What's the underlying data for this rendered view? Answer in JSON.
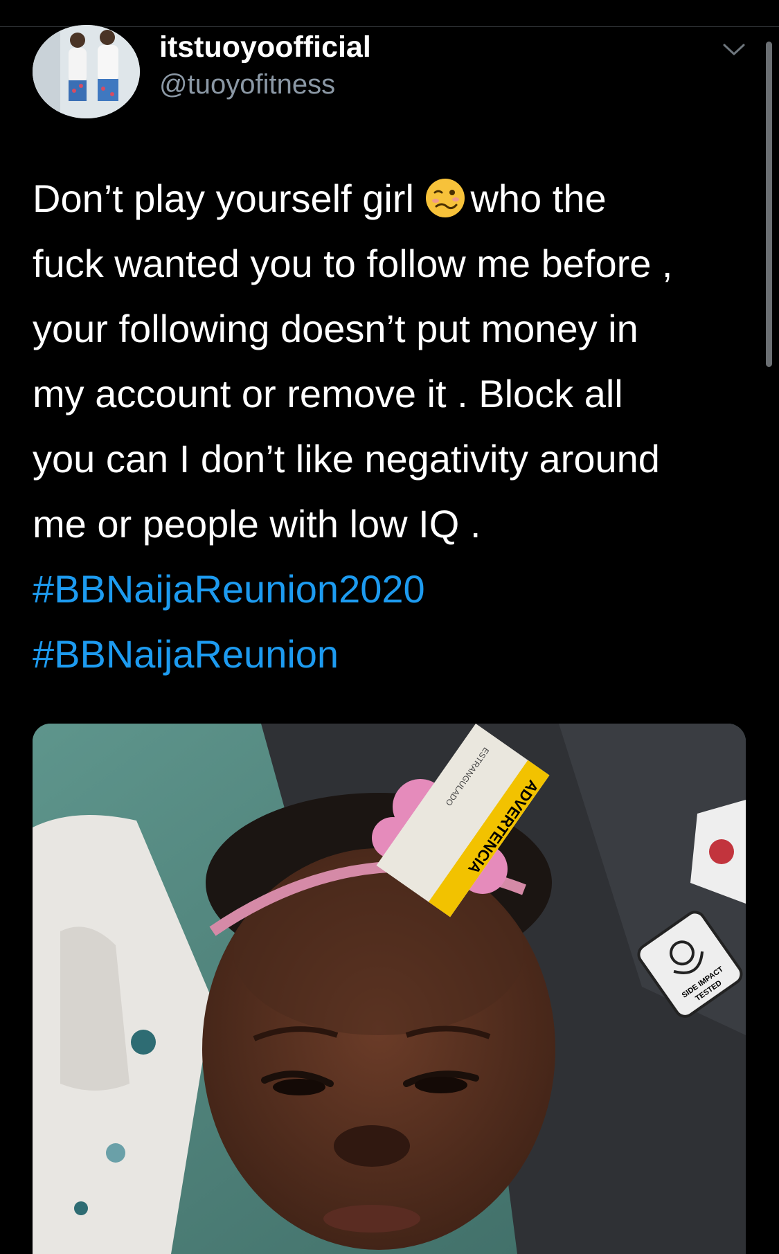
{
  "user": {
    "display_name": "itstuoyoofficial",
    "handle": "@tuoyofitness"
  },
  "icons": {
    "avatar": "profile-photo",
    "menu": "chevron-down-icon",
    "emoji": "woozy-face-emoji"
  },
  "tweet": {
    "lines": [
      "Don’t play yourself girl",
      "who  the",
      "fuck wanted you to follow me before ,",
      "your following doesn’t put money in",
      "my account or remove it . Block all",
      "you can I don’t like negativity around",
      "me or people with low IQ ."
    ],
    "hashtags": [
      "#BBNaijaReunion2020",
      "#BBNaijaReunion"
    ]
  },
  "media": {
    "seat_label": "ADVERTENCIA",
    "strap_text": "ESTRANGULADO",
    "badge_line1": "SIDE IMPACT",
    "badge_line2": "TESTED"
  },
  "colors": {
    "background": "#000000",
    "hashtag": "#1d9bf0",
    "handle": "#8b98a5"
  }
}
